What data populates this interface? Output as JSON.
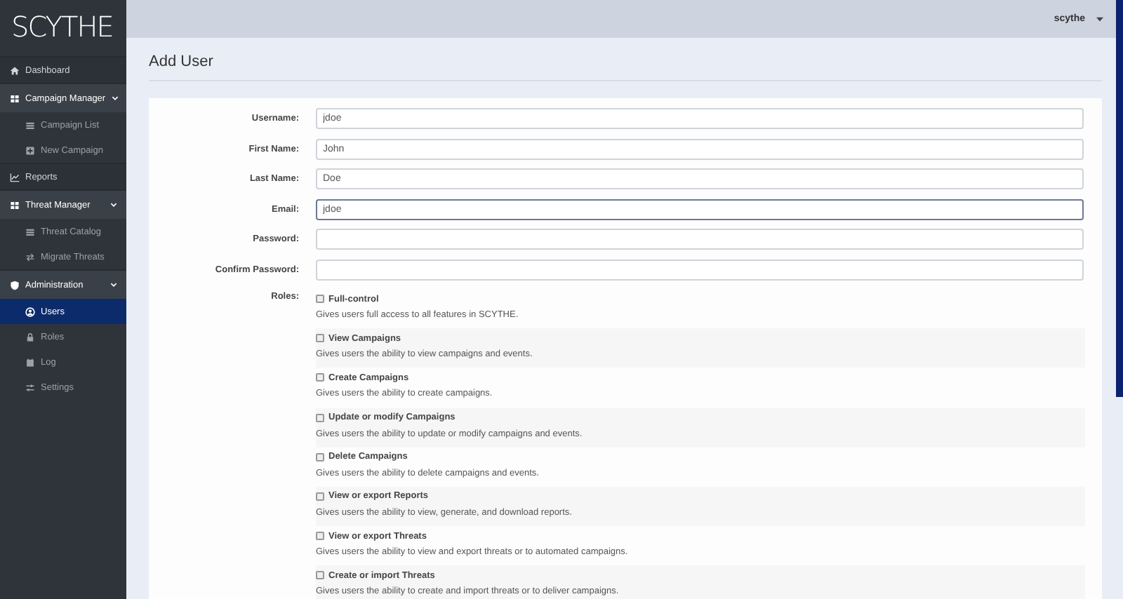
{
  "sidebar": {
    "logo": "SCYTHE",
    "items": [
      {
        "label": "Dashboard",
        "selected": false
      },
      {
        "label": "Campaign Manager",
        "expanded": true,
        "selected": false,
        "children": [
          {
            "label": "Campaign List",
            "selected": false
          },
          {
            "label": "New Campaign",
            "selected": false
          }
        ]
      },
      {
        "label": "Reports",
        "selected": false
      },
      {
        "label": "Threat Manager",
        "expanded": true,
        "selected": false,
        "children": [
          {
            "label": "Threat Catalog",
            "selected": false
          },
          {
            "label": "Migrate Threats",
            "selected": false
          }
        ]
      },
      {
        "label": "Administration",
        "expanded": true,
        "selected": false,
        "children": [
          {
            "label": "Users",
            "selected": true
          },
          {
            "label": "Roles",
            "selected": false
          },
          {
            "label": "Log",
            "selected": false
          },
          {
            "label": "Settings",
            "selected": false
          }
        ]
      }
    ]
  },
  "topbar": {
    "user": "scythe"
  },
  "page": {
    "title": "Add User"
  },
  "form": {
    "fields": [
      {
        "label": "Username:",
        "value": "jdoe",
        "focused": false
      },
      {
        "label": "First Name:",
        "value": "John",
        "focused": false
      },
      {
        "label": "Last Name:",
        "value": "Doe",
        "focused": false
      },
      {
        "label": "Email:",
        "value": "jdoe",
        "focused": true
      },
      {
        "label": "Password:",
        "focused": false
      },
      {
        "label": "Confirm Password:",
        "focused": false
      }
    ],
    "roles_label": "Roles:",
    "roles": [
      {
        "name": "Full-control",
        "description": "Gives users full access to all features in SCYTHE.",
        "checked": false
      },
      {
        "name": "View Campaigns",
        "description": "Gives users the ability to view campaigns and events.",
        "checked": false
      },
      {
        "name": "Create Campaigns",
        "description": "Gives users the ability to create campaigns.",
        "checked": false
      },
      {
        "name": "Update or modify Campaigns",
        "description": "Gives users the ability to update or modify campaigns and events.",
        "checked": false
      },
      {
        "name": "Delete Campaigns",
        "description": "Gives users the ability to delete campaigns and events.",
        "checked": false
      },
      {
        "name": "View or export Reports",
        "description": "Gives users the ability to view, generate, and download reports.",
        "checked": false
      },
      {
        "name": "View or export Threats",
        "description": "Gives users the ability to view and export threats or to automated campaigns.",
        "checked": false
      },
      {
        "name": "Create or import Threats",
        "description": "Gives users the ability to create and import threats or to deliver campaigns.",
        "checked": false
      }
    ]
  }
}
